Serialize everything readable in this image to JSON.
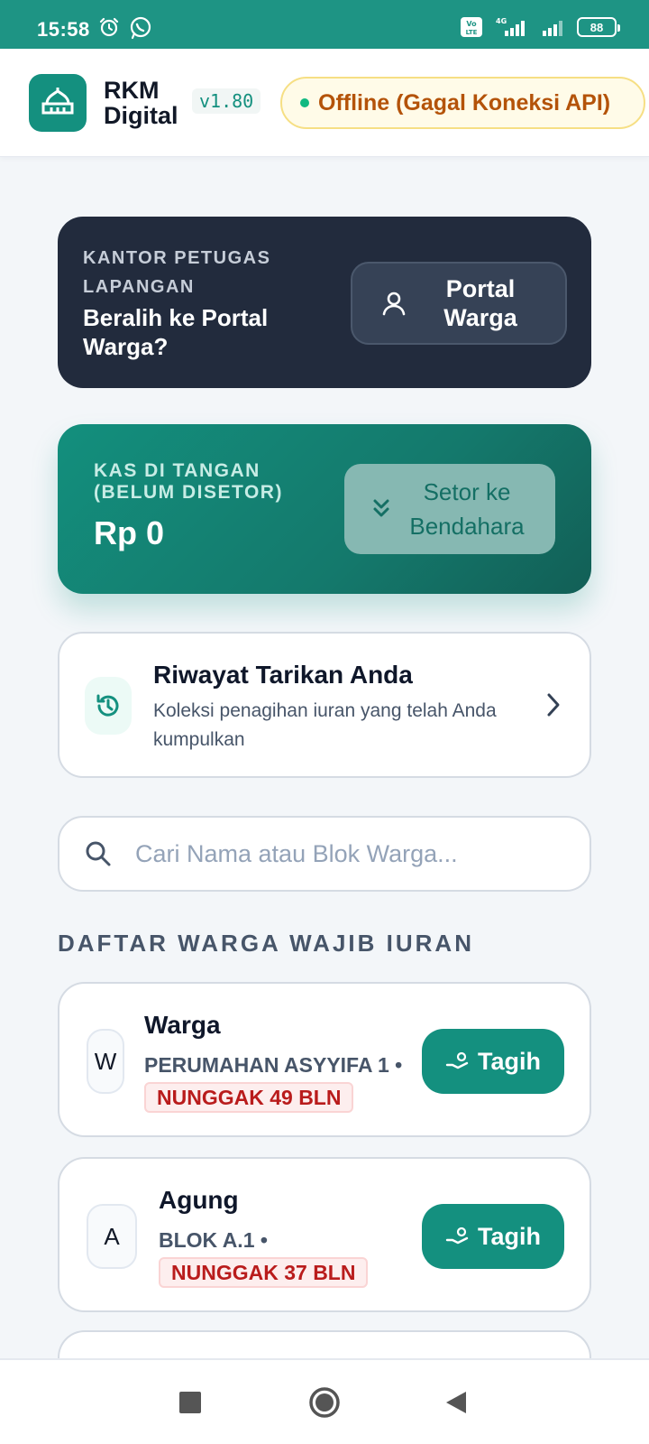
{
  "status_bar": {
    "time": "15:58",
    "battery": "88"
  },
  "header": {
    "app_name_line1": "RKM",
    "app_name_line2": "Digital",
    "version": "v1.80",
    "status": "Offline (Gagal Koneksi API)"
  },
  "portal_card": {
    "label": "KANTOR PETUGAS LAPANGAN",
    "title": "Beralih ke Portal Warga?",
    "button": "Portal Warga"
  },
  "kas_card": {
    "label": "KAS DI TANGAN (BELUM DISETOR)",
    "amount": "Rp 0",
    "button": "Setor ke Bendahara"
  },
  "history_card": {
    "title": "Riwayat Tarikan Anda",
    "description": "Koleksi penagihan iuran yang telah Anda kumpulkan"
  },
  "search": {
    "placeholder": "Cari Nama atau Blok Warga..."
  },
  "section_title": "DAFTAR WARGA WAJIB IURAN",
  "residents": [
    {
      "initial": "W",
      "name": "Warga",
      "block": "PERUMAHAN ASYYIFA 1 •",
      "arrears": "NUNGGAK 49 BLN",
      "action": "Tagih"
    },
    {
      "initial": "A",
      "name": "Agung",
      "block": "BLOK A.1 •",
      "arrears": "NUNGGAK 37 BLN",
      "action": "Tagih"
    }
  ],
  "colors": {
    "primary": "#14907f",
    "dark_card": "#222b3d",
    "warning_bg": "#fffbe8",
    "danger": "#b91c1c"
  }
}
